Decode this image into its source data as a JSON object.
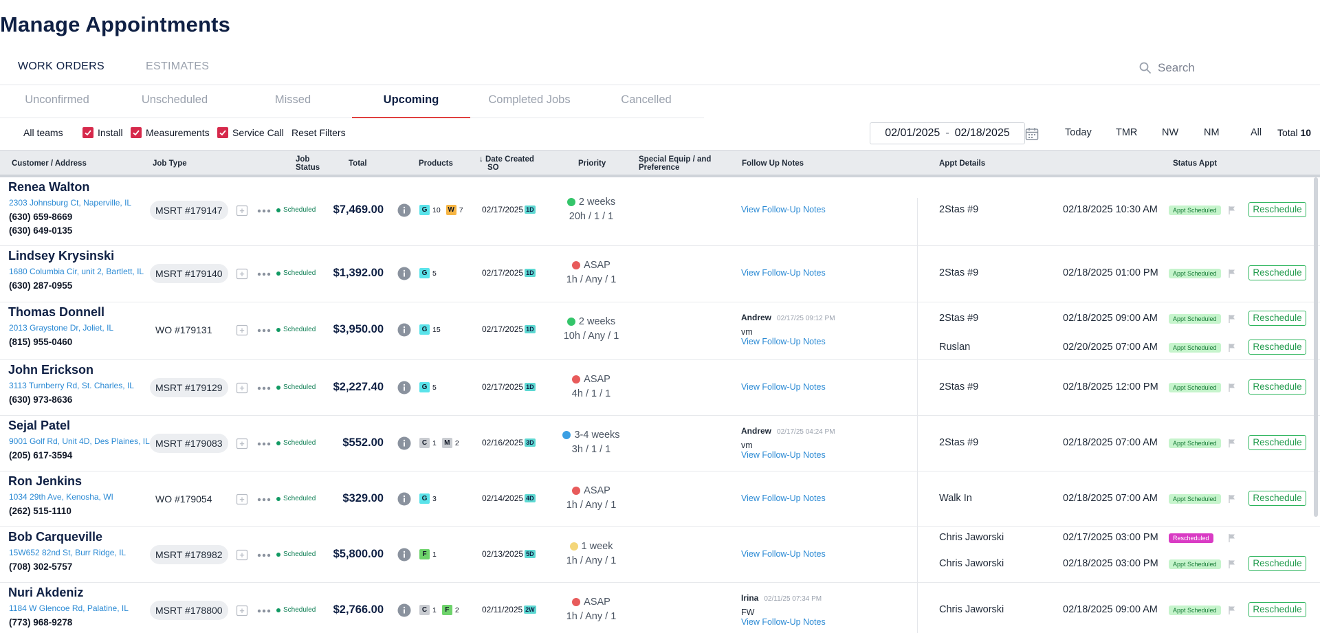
{
  "page": {
    "title": "Manage Appointments"
  },
  "top_tabs": {
    "work_orders": "WORK ORDERS",
    "estimates": "ESTIMATES"
  },
  "search": {
    "placeholder": "Search"
  },
  "sub_tabs": [
    "Unconfirmed",
    "Unscheduled",
    "Missed",
    "Upcoming",
    "Completed Jobs",
    "Cancelled"
  ],
  "active_sub_tab": "Upcoming",
  "filters": {
    "teams": "All teams",
    "install": "Install",
    "measurements": "Measurements",
    "service_call": "Service Call",
    "reset": "Reset Filters",
    "date_from": "02/01/2025",
    "date_to": "02/18/2025",
    "date_sep": "-",
    "quick": [
      "Today",
      "TMR",
      "NW",
      "NM",
      "All"
    ],
    "total_label": "Total",
    "total_value": "10"
  },
  "columns": {
    "customer": "Customer / Address",
    "job_type": "Job Type",
    "job_status_1": "Job",
    "job_status_2": "Status",
    "total": "Total",
    "products": "Products",
    "date_created_1": "Date Created",
    "date_created_2": "SO",
    "sort_arrow": "↓",
    "priority": "Priority",
    "special_1": "Special Equip / and",
    "special_2": "Preference",
    "follow_up": "Follow Up Notes",
    "appt_details": "Appt Details",
    "status_appt": "Status Appt"
  },
  "colors": {
    "scheduled_badge": "#c6f4cc",
    "rescheduled_badge": "#d93bc4",
    "reschedule_button": "#2bb45b",
    "active_tab_underline": "#e0403f",
    "checkbox": "#d6294b"
  },
  "rows": [
    {
      "name": "Renea Walton",
      "address": "2303 Johnsburg Ct, Naperville, IL",
      "phones": [
        "(630) 659-8669",
        "(630) 649-0135"
      ],
      "job": "MSRT #179147",
      "job_pill": true,
      "status": "Scheduled",
      "total": "$7,469.00",
      "products": [
        {
          "code": "G",
          "qty": "10"
        },
        {
          "code": "W",
          "qty": "7"
        }
      ],
      "date": "02/17/2025",
      "age": "1D",
      "priority": "2 weeks",
      "priority_color": "green",
      "priority_detail": "20h / 1 / 1",
      "follow_up": {
        "author": "",
        "time": "",
        "note": "",
        "link": "View Follow-Up Notes"
      },
      "appts": [
        {
          "name": "2Stas #9",
          "date": "02/18/2025 10:30 AM",
          "badge": "Appt Scheduled",
          "badge_type": "sched",
          "button": "Reschedule"
        }
      ]
    },
    {
      "name": "Lindsey Krysinski",
      "address": "1680 Columbia Cir, unit 2, Bartlett, IL",
      "phones": [
        "(630) 287-0955"
      ],
      "job": "MSRT #179140",
      "job_pill": true,
      "status": "Scheduled",
      "total": "$1,392.00",
      "products": [
        {
          "code": "G",
          "qty": "5"
        }
      ],
      "date": "02/17/2025",
      "age": "1D",
      "priority": "ASAP",
      "priority_color": "red",
      "priority_detail": "1h / Any / 1",
      "follow_up": {
        "author": "",
        "time": "",
        "note": "",
        "link": "View Follow-Up Notes"
      },
      "appts": [
        {
          "name": "2Stas #9",
          "date": "02/18/2025 01:00 PM",
          "badge": "Appt Scheduled",
          "badge_type": "sched",
          "button": "Reschedule"
        }
      ]
    },
    {
      "name": "Thomas Donnell",
      "address": "2013 Graystone Dr, Joliet, IL",
      "phones": [
        "(815) 955-0460"
      ],
      "job": "WO #179131",
      "job_pill": false,
      "status": "Scheduled",
      "total": "$3,950.00",
      "products": [
        {
          "code": "G",
          "qty": "15"
        }
      ],
      "date": "02/17/2025",
      "age": "1D",
      "priority": "2 weeks",
      "priority_color": "green",
      "priority_detail": "10h / Any / 1",
      "follow_up": {
        "author": "Andrew",
        "time": "02/17/25 09:12 PM",
        "note": "vm",
        "link": "View Follow-Up Notes"
      },
      "appts": [
        {
          "name": "2Stas #9",
          "date": "02/18/2025 09:00 AM",
          "badge": "Appt Scheduled",
          "badge_type": "sched",
          "button": "Reschedule"
        },
        {
          "name": "Ruslan",
          "date": "02/20/2025 07:00 AM",
          "badge": "Appt Scheduled",
          "badge_type": "sched",
          "button": "Reschedule"
        }
      ]
    },
    {
      "name": "John Erickson",
      "address": "3113 Turnberry Rd, St. Charles, IL",
      "phones": [
        "(630) 973-8636"
      ],
      "job": "MSRT #179129",
      "job_pill": true,
      "status": "Scheduled",
      "total": "$2,227.40",
      "products": [
        {
          "code": "G",
          "qty": "5"
        }
      ],
      "date": "02/17/2025",
      "age": "1D",
      "priority": "ASAP",
      "priority_color": "red",
      "priority_detail": "4h / 1 / 1",
      "follow_up": {
        "author": "",
        "time": "",
        "note": "",
        "link": "View Follow-Up Notes"
      },
      "appts": [
        {
          "name": "2Stas #9",
          "date": "02/18/2025 12:00 PM",
          "badge": "Appt Scheduled",
          "badge_type": "sched",
          "button": "Reschedule"
        }
      ]
    },
    {
      "name": "Sejal Patel",
      "address": "9001 Golf Rd, Unit 4D, Des Plaines, IL",
      "phones": [
        "(205) 617-3594"
      ],
      "job": "MSRT #179083",
      "job_pill": true,
      "status": "Scheduled",
      "total": "$552.00",
      "products": [
        {
          "code": "C",
          "qty": "1"
        },
        {
          "code": "M",
          "qty": "2"
        }
      ],
      "date": "02/16/2025",
      "age": "3D",
      "priority": "3-4 weeks",
      "priority_color": "blue",
      "priority_detail": "3h / 1 / 1",
      "follow_up": {
        "author": "Andrew",
        "time": "02/17/25 04:24 PM",
        "note": "vm",
        "link": "View Follow-Up Notes"
      },
      "appts": [
        {
          "name": "2Stas #9",
          "date": "02/18/2025 07:00 AM",
          "badge": "Appt Scheduled",
          "badge_type": "sched",
          "button": "Reschedule"
        }
      ]
    },
    {
      "name": "Ron Jenkins",
      "address": "1034 29th Ave, Kenosha, WI",
      "phones": [
        "(262) 515-1110"
      ],
      "job": "WO #179054",
      "job_pill": false,
      "status": "Scheduled",
      "total": "$329.00",
      "products": [
        {
          "code": "G",
          "qty": "3"
        }
      ],
      "date": "02/14/2025",
      "age": "4D",
      "priority": "ASAP",
      "priority_color": "red",
      "priority_detail": "1h / Any / 1",
      "follow_up": {
        "author": "",
        "time": "",
        "note": "",
        "link": "View Follow-Up Notes"
      },
      "appts": [
        {
          "name": "Walk In",
          "date": "02/18/2025 07:00 AM",
          "badge": "Appt Scheduled",
          "badge_type": "sched",
          "button": "Reschedule"
        }
      ]
    },
    {
      "name": "Bob Carqueville",
      "address": "15W652 82nd St, Burr Ridge, IL",
      "phones": [
        "(708) 302-5757"
      ],
      "job": "MSRT #178982",
      "job_pill": true,
      "status": "Scheduled",
      "total": "$5,800.00",
      "products": [
        {
          "code": "F",
          "qty": "1"
        }
      ],
      "date": "02/13/2025",
      "age": "5D",
      "priority": "1 week",
      "priority_color": "yellow",
      "priority_detail": "1h / Any / 1",
      "follow_up": {
        "author": "",
        "time": "",
        "note": "",
        "link": "View Follow-Up Notes"
      },
      "appts": [
        {
          "name": "Chris Jaworski",
          "date": "02/17/2025 03:00 PM",
          "badge": "Rescheduled",
          "badge_type": "resch",
          "button": ""
        },
        {
          "name": "Chris Jaworski",
          "date": "02/18/2025 03:00 PM",
          "badge": "Appt Scheduled",
          "badge_type": "sched",
          "button": "Reschedule"
        }
      ]
    },
    {
      "name": "Nuri Akdeniz",
      "address": "1184 W Glencoe Rd, Palatine, IL",
      "phones": [
        "(773) 968-9278"
      ],
      "job": "MSRT #178800",
      "job_pill": true,
      "status": "Scheduled",
      "total": "$2,766.00",
      "products": [
        {
          "code": "C",
          "qty": "1"
        },
        {
          "code": "F",
          "qty": "2"
        }
      ],
      "date": "02/11/2025",
      "age": "2W",
      "priority": "ASAP",
      "priority_color": "red",
      "priority_detail": "1h / Any / 1",
      "follow_up": {
        "author": "Irina",
        "time": "02/11/25 07:34 PM",
        "note": "FW",
        "link": "View Follow-Up Notes"
      },
      "appts": [
        {
          "name": "Chris Jaworski",
          "date": "02/18/2025 09:00 AM",
          "badge": "Appt Scheduled",
          "badge_type": "sched",
          "button": "Reschedule"
        }
      ]
    }
  ]
}
